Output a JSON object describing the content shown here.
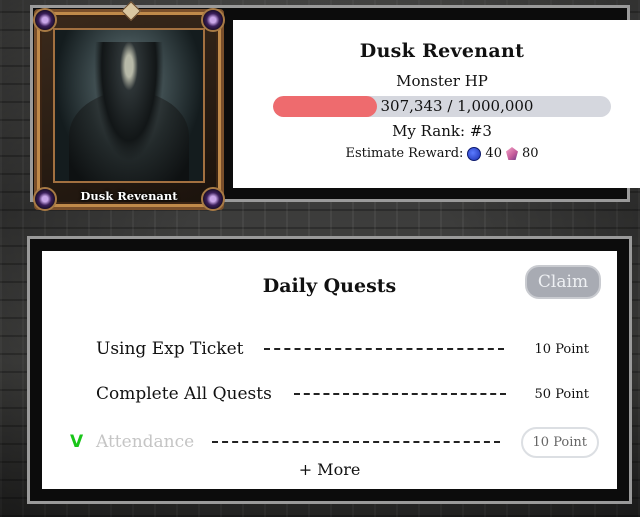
{
  "boss": {
    "name": "Dusk Revenant",
    "hp_label": "Monster HP",
    "hp_text": "307,343 / 1,000,000",
    "hp_current": 307343,
    "hp_max": 1000000,
    "rank": "My Rank: #3",
    "reward_label": "Estimate Reward:",
    "reward_coin": "40",
    "reward_gem": "80",
    "hp_color": "#ee6b6e",
    "card_title": "Dusk Revenant"
  },
  "quests": {
    "title": "Daily Quests",
    "claim_label": "Claim",
    "items": [
      {
        "name": "Using Exp Ticket",
        "points": "10 Point",
        "done": false
      },
      {
        "name": "Complete All Quests",
        "points": "50 Point",
        "done": false
      },
      {
        "name": "Attendance",
        "points": "10 Point",
        "done": true,
        "check": "V"
      }
    ],
    "more_label": "+ More"
  }
}
